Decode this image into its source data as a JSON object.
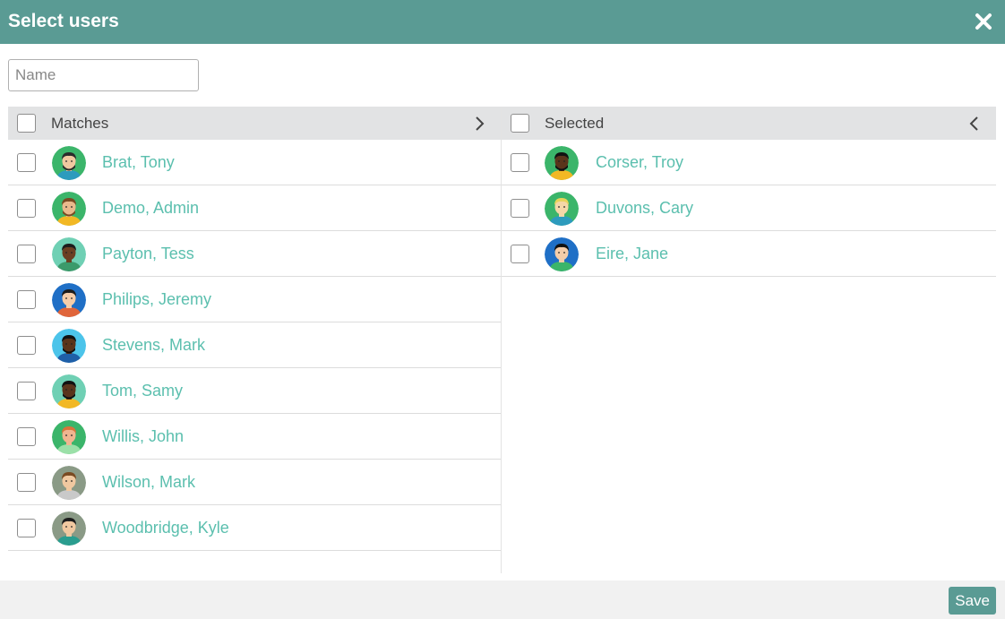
{
  "dialog": {
    "title": "Select users"
  },
  "search": {
    "placeholder": "Name",
    "value": ""
  },
  "matches": {
    "header_label": "Matches",
    "items": [
      {
        "name": "Brat, Tony",
        "avatar_bg": "#3bb56a",
        "skin": "#f0c8a0",
        "hair": "#2b2b2b",
        "shirt": "#2d9bbd",
        "beard": true
      },
      {
        "name": "Demo, Admin",
        "avatar_bg": "#3bb56a",
        "skin": "#e9b98c",
        "hair": "#7a4a22",
        "shirt": "#f2b824",
        "beard": true
      },
      {
        "name": "Payton, Tess",
        "avatar_bg": "#6fd0b4",
        "skin": "#6b3f22",
        "hair": "#1c1c1c",
        "shirt": "#3b9a6b",
        "beard": false
      },
      {
        "name": "Philips, Jeremy",
        "avatar_bg": "#1f6fc6",
        "skin": "#f5cda9",
        "hair": "#1c1c1c",
        "shirt": "#e0653a",
        "beard": false
      },
      {
        "name": "Stevens, Mark",
        "avatar_bg": "#4cc4ea",
        "skin": "#5a341b",
        "hair": "#111111",
        "shirt": "#1f5fa8",
        "beard": true
      },
      {
        "name": "Tom, Samy",
        "avatar_bg": "#6fd0b4",
        "skin": "#5a341b",
        "hair": "#111111",
        "shirt": "#f2b824",
        "beard": true
      },
      {
        "name": "Willis, John",
        "avatar_bg": "#3bb56a",
        "skin": "#f0b590",
        "hair": "#d9733a",
        "shirt": "#9be0a8",
        "beard": false
      },
      {
        "name": "Wilson, Mark",
        "avatar_bg": "#8a9a86",
        "skin": "#f0c8a0",
        "hair": "#7a4a22",
        "shirt": "#c9c9c9",
        "beard": false
      },
      {
        "name": "Woodbridge, Kyle",
        "avatar_bg": "#8a9a86",
        "skin": "#f0c8a0",
        "hair": "#1c1c1c",
        "shirt": "#2a9d8f",
        "beard": false
      }
    ]
  },
  "selected": {
    "header_label": "Selected",
    "items": [
      {
        "name": "Corser, Troy",
        "avatar_bg": "#3bb56a",
        "skin": "#5a341b",
        "hair": "#111111",
        "shirt": "#f2b824",
        "beard": true
      },
      {
        "name": "Duvons, Cary",
        "avatar_bg": "#3bb56a",
        "skin": "#f5d7a8",
        "hair": "#e8d35a",
        "shirt": "#2d9bbd",
        "beard": false
      },
      {
        "name": "Eire, Jane",
        "avatar_bg": "#1f6fc6",
        "skin": "#f5cda9",
        "hair": "#111111",
        "shirt": "#3bb56a",
        "beard": false
      }
    ]
  },
  "footer": {
    "save_label": "Save"
  },
  "colors": {
    "accent": "#5a9b94",
    "link": "#5bbfae",
    "header_bar": "#e2e3e4"
  },
  "icons": {
    "close": "close-icon",
    "move_right": "chevron-right-icon",
    "move_left": "chevron-left-icon"
  }
}
